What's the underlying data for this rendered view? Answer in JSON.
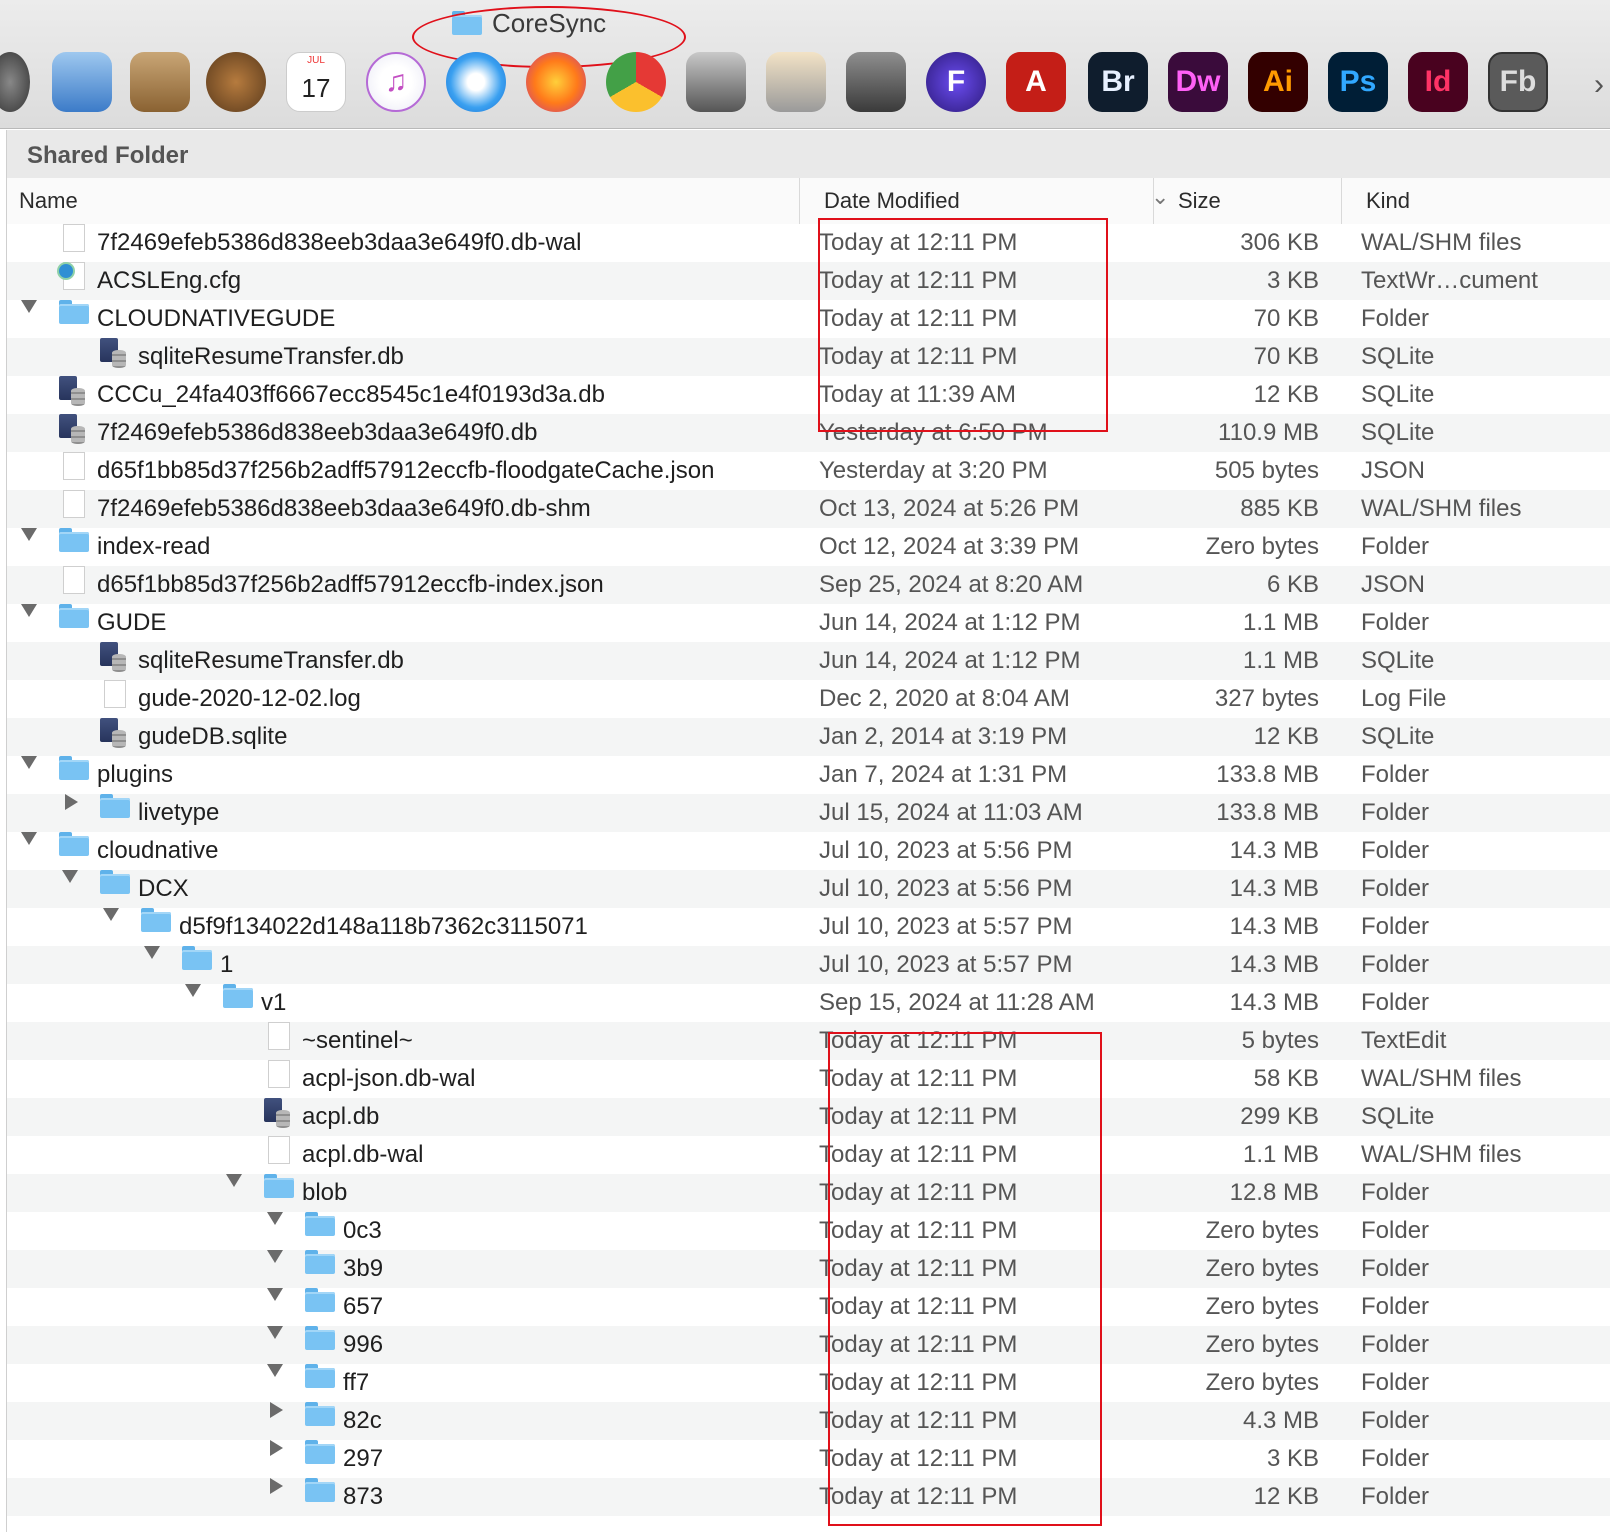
{
  "window": {
    "title": "CoreSync"
  },
  "dock": {
    "apps": [
      {
        "name": "system-preferences",
        "label": ""
      },
      {
        "name": "mail",
        "label": ""
      },
      {
        "name": "contacts",
        "label": ""
      },
      {
        "name": "automator",
        "label": ""
      },
      {
        "name": "calendar",
        "label": "17",
        "month": "JUL"
      },
      {
        "name": "itunes",
        "label": "♫"
      },
      {
        "name": "safari",
        "label": ""
      },
      {
        "name": "firefox",
        "label": ""
      },
      {
        "name": "chrome",
        "label": ""
      },
      {
        "name": "image-capture",
        "label": ""
      },
      {
        "name": "preview",
        "label": ""
      },
      {
        "name": "scanner",
        "label": ""
      },
      {
        "name": "frame",
        "label": "F"
      },
      {
        "name": "acrobat",
        "label": "A"
      },
      {
        "name": "bridge",
        "label": "Br"
      },
      {
        "name": "dreamweaver",
        "label": "Dw"
      },
      {
        "name": "illustrator",
        "label": "Ai"
      },
      {
        "name": "photoshop",
        "label": "Ps"
      },
      {
        "name": "indesign",
        "label": "Id"
      },
      {
        "name": "flash-builder",
        "label": "Fb"
      }
    ],
    "more": "›"
  },
  "path_bar": {
    "title": "Shared Folder"
  },
  "columns": {
    "name": "Name",
    "date": "Date Modified",
    "size": "Size",
    "kind": "Kind"
  },
  "rows": [
    {
      "name": "7f2469efeb5386d838eeb3daa3e649f0.db-wal",
      "date": "Today at 12:11 PM",
      "size": "306 KB",
      "kind": "WAL/SHM files",
      "level": 0,
      "icon": "doc",
      "disc": ""
    },
    {
      "name": "ACSLEng.cfg",
      "date": "Today at 12:11 PM",
      "size": "3 KB",
      "kind": "TextWr…cument",
      "level": 0,
      "icon": "cfg",
      "disc": ""
    },
    {
      "name": "CLOUDNATIVEGUDE",
      "date": "Today at 12:11 PM",
      "size": "70 KB",
      "kind": "Folder",
      "level": 0,
      "icon": "folder",
      "disc": "open"
    },
    {
      "name": "sqliteResumeTransfer.db",
      "date": "Today at 12:11 PM",
      "size": "70 KB",
      "kind": "SQLite",
      "level": 1,
      "icon": "db",
      "disc": ""
    },
    {
      "name": "CCCu_24fa403ff6667ecc8545c1e4f0193d3a.db",
      "date": "Today at 11:39 AM",
      "size": "12 KB",
      "kind": "SQLite",
      "level": 0,
      "icon": "db",
      "disc": ""
    },
    {
      "name": "7f2469efeb5386d838eeb3daa3e649f0.db",
      "date": "Yesterday at 6:50 PM",
      "size": "110.9 MB",
      "kind": "SQLite",
      "level": 0,
      "icon": "db",
      "disc": ""
    },
    {
      "name": "d65f1bb85d37f256b2adff57912eccfb-floodgateCache.json",
      "date": "Yesterday at 3:20 PM",
      "size": "505 bytes",
      "kind": "JSON",
      "level": 0,
      "icon": "doc",
      "disc": ""
    },
    {
      "name": "7f2469efeb5386d838eeb3daa3e649f0.db-shm",
      "date": "Oct 13, 2024 at 5:26 PM",
      "size": "885 KB",
      "kind": "WAL/SHM files",
      "level": 0,
      "icon": "doc",
      "disc": ""
    },
    {
      "name": "index-read",
      "date": "Oct 12, 2024 at 3:39 PM",
      "size": "Zero bytes",
      "kind": "Folder",
      "level": 0,
      "icon": "folder",
      "disc": "open"
    },
    {
      "name": "d65f1bb85d37f256b2adff57912eccfb-index.json",
      "date": "Sep 25, 2024 at 8:20 AM",
      "size": "6 KB",
      "kind": "JSON",
      "level": 0,
      "icon": "doc",
      "disc": ""
    },
    {
      "name": "GUDE",
      "date": "Jun 14, 2024 at 1:12 PM",
      "size": "1.1 MB",
      "kind": "Folder",
      "level": 0,
      "icon": "folder",
      "disc": "open"
    },
    {
      "name": "sqliteResumeTransfer.db",
      "date": "Jun 14, 2024 at 1:12 PM",
      "size": "1.1 MB",
      "kind": "SQLite",
      "level": 1,
      "icon": "db",
      "disc": ""
    },
    {
      "name": "gude-2020-12-02.log",
      "date": "Dec 2, 2020 at 8:04 AM",
      "size": "327 bytes",
      "kind": "Log File",
      "level": 1,
      "icon": "doc",
      "disc": ""
    },
    {
      "name": "gudeDB.sqlite",
      "date": "Jan 2, 2014 at 3:19 PM",
      "size": "12 KB",
      "kind": "SQLite",
      "level": 1,
      "icon": "db",
      "disc": ""
    },
    {
      "name": "plugins",
      "date": "Jan 7, 2024 at 1:31 PM",
      "size": "133.8 MB",
      "kind": "Folder",
      "level": 0,
      "icon": "folder",
      "disc": "open"
    },
    {
      "name": "livetype",
      "date": "Jul 15, 2024 at 11:03 AM",
      "size": "133.8 MB",
      "kind": "Folder",
      "level": 1,
      "icon": "folder",
      "disc": "closed"
    },
    {
      "name": "cloudnative",
      "date": "Jul 10, 2023 at 5:56 PM",
      "size": "14.3 MB",
      "kind": "Folder",
      "level": 0,
      "icon": "folder",
      "disc": "open"
    },
    {
      "name": "DCX",
      "date": "Jul 10, 2023 at 5:56 PM",
      "size": "14.3 MB",
      "kind": "Folder",
      "level": 1,
      "icon": "folder",
      "disc": "open"
    },
    {
      "name": "d5f9f134022d148a118b7362c3115071",
      "date": "Jul 10, 2023 at 5:57 PM",
      "size": "14.3 MB",
      "kind": "Folder",
      "level": 2,
      "icon": "folder",
      "disc": "open"
    },
    {
      "name": "1",
      "date": "Jul 10, 2023 at 5:57 PM",
      "size": "14.3 MB",
      "kind": "Folder",
      "level": 3,
      "icon": "folder",
      "disc": "open"
    },
    {
      "name": "v1",
      "date": "Sep 15, 2024 at 11:28 AM",
      "size": "14.3 MB",
      "kind": "Folder",
      "level": 4,
      "icon": "folder",
      "disc": "open"
    },
    {
      "name": "~sentinel~",
      "date": "Today at 12:11 PM",
      "size": "5 bytes",
      "kind": "TextEdit",
      "level": 5,
      "icon": "doc",
      "disc": ""
    },
    {
      "name": "acpl-json.db-wal",
      "date": "Today at 12:11 PM",
      "size": "58 KB",
      "kind": "WAL/SHM files",
      "level": 5,
      "icon": "doc",
      "disc": ""
    },
    {
      "name": "acpl.db",
      "date": "Today at 12:11 PM",
      "size": "299 KB",
      "kind": "SQLite",
      "level": 5,
      "icon": "db",
      "disc": ""
    },
    {
      "name": "acpl.db-wal",
      "date": "Today at 12:11 PM",
      "size": "1.1 MB",
      "kind": "WAL/SHM files",
      "level": 5,
      "icon": "doc",
      "disc": ""
    },
    {
      "name": "blob",
      "date": "Today at 12:11 PM",
      "size": "12.8 MB",
      "kind": "Folder",
      "level": 5,
      "icon": "folder",
      "disc": "open"
    },
    {
      "name": "0c3",
      "date": "Today at 12:11 PM",
      "size": "Zero bytes",
      "kind": "Folder",
      "level": 6,
      "icon": "folder",
      "disc": "open"
    },
    {
      "name": "3b9",
      "date": "Today at 12:11 PM",
      "size": "Zero bytes",
      "kind": "Folder",
      "level": 6,
      "icon": "folder",
      "disc": "open"
    },
    {
      "name": "657",
      "date": "Today at 12:11 PM",
      "size": "Zero bytes",
      "kind": "Folder",
      "level": 6,
      "icon": "folder",
      "disc": "open"
    },
    {
      "name": "996",
      "date": "Today at 12:11 PM",
      "size": "Zero bytes",
      "kind": "Folder",
      "level": 6,
      "icon": "folder",
      "disc": "open"
    },
    {
      "name": "ff7",
      "date": "Today at 12:11 PM",
      "size": "Zero bytes",
      "kind": "Folder",
      "level": 6,
      "icon": "folder",
      "disc": "open"
    },
    {
      "name": "82c",
      "date": "Today at 12:11 PM",
      "size": "4.3 MB",
      "kind": "Folder",
      "level": 6,
      "icon": "folder",
      "disc": "closed"
    },
    {
      "name": "297",
      "date": "Today at 12:11 PM",
      "size": "3 KB",
      "kind": "Folder",
      "level": 6,
      "icon": "folder",
      "disc": "closed"
    },
    {
      "name": "873",
      "date": "Today at 12:11 PM",
      "size": "12 KB",
      "kind": "Folder",
      "level": 6,
      "icon": "folder",
      "disc": "closed"
    }
  ],
  "colors": {
    "annotation": "#e0101a",
    "folder": "#79c3f3"
  }
}
